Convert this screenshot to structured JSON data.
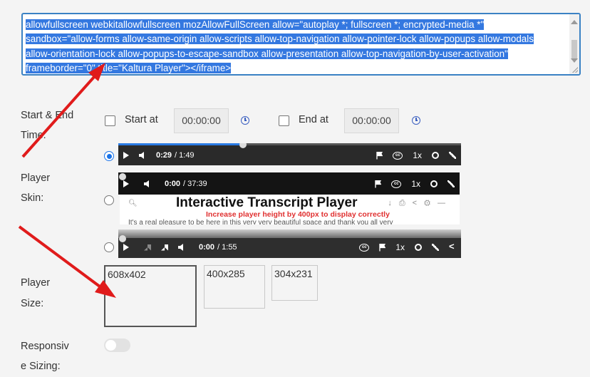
{
  "embed_code": {
    "lines": [
      "allowfullscreen webkitallowfullscreen mozAllowFullScreen allow=\"autoplay *; fullscreen *; encrypted-media *\"",
      "sandbox=\"allow-forms allow-same-origin allow-scripts allow-top-navigation allow-pointer-lock allow-popups allow-modals",
      "allow-orientation-lock allow-popups-to-escape-sandbox allow-presentation allow-top-navigation-by-user-activation\"",
      "frameborder=\"0\" title=\"Kaltura Player\"></iframe>"
    ]
  },
  "start_end": {
    "label_line1": "Start & End",
    "label_line2": "Time:",
    "start_label": "Start at",
    "start_value": "00:00:00",
    "end_label": "End at",
    "end_value": "00:00:00",
    "clock_icon": "clock-icon"
  },
  "player_skin": {
    "label_line1": "Player",
    "label_line2": "Skin:",
    "selected_index": 0,
    "skins": [
      {
        "time": "0:29",
        "duration": "/ 1:49",
        "speed": "1x",
        "progress": 0.45
      },
      {
        "time": "0:00",
        "duration": "/ 37:39",
        "speed": "1x",
        "progress": 0.0
      },
      {
        "time": "0:00",
        "duration": "/ 1:55",
        "speed": "1x",
        "progress": 0.0
      }
    ],
    "transcript": {
      "title": "Interactive Transcript Player",
      "subtitle": "Increase player height by 400px to display correctly",
      "body": "It's a real pleasure to be here in this very very beautiful space and thank you all very"
    }
  },
  "player_size": {
    "label_line1": "Player",
    "label_line2": "Size:",
    "options": [
      "608x402",
      "400x285",
      "304x231"
    ],
    "selected_index": 0
  },
  "responsive": {
    "label_line1": "Responsiv",
    "label_line2": "e Sizing:",
    "enabled": false
  },
  "colors": {
    "selection": "#3478e0",
    "focus_border": "#3b82c4",
    "annotation_arrow": "#e01b1b",
    "radio_checked": "#1a73e8"
  }
}
